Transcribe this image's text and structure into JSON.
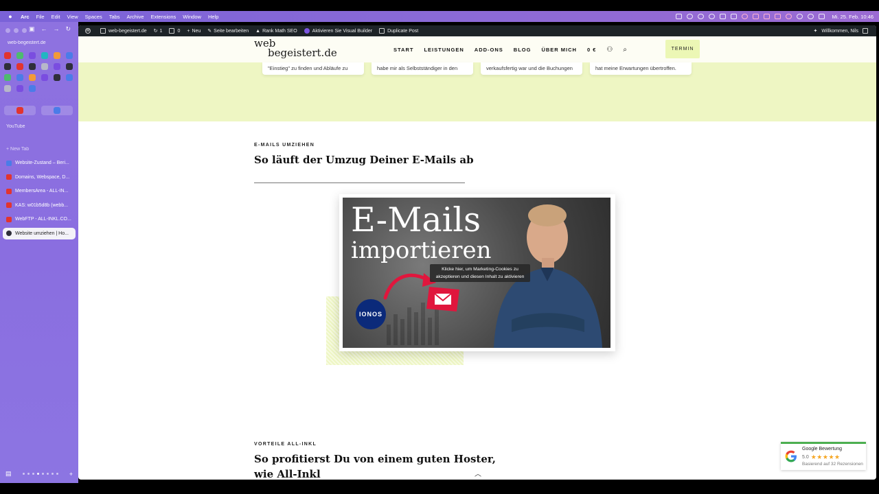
{
  "menubar": {
    "app": "Arc",
    "items": [
      "File",
      "Edit",
      "View",
      "Spaces",
      "Tabs",
      "Archive",
      "Extensions",
      "Window",
      "Help"
    ],
    "clock": "Mi. 25. Feb. 10:46"
  },
  "sidebar": {
    "url": "web-begeistert.de",
    "section_label": "YouTube",
    "new_tab": "+ New Tab",
    "tabs": [
      {
        "label": "Website-Zustand – Beri...",
        "color": "#4b7ce8"
      },
      {
        "label": "Domains, Webspace, D...",
        "color": "#e2342f"
      },
      {
        "label": "MembersArea - ALL-IN...",
        "color": "#e2342f"
      },
      {
        "label": "KAS: w01b5d8b (webb...",
        "color": "#e2342f"
      },
      {
        "label": "WebFTP - ALL-INKL.CO...",
        "color": "#e2342f"
      },
      {
        "label": "Website umziehen | Ho...",
        "color": "#2f2f3a"
      }
    ]
  },
  "wpbar": {
    "site": "web-begeistert.de",
    "updates": "1",
    "comments": "0",
    "new": "Neu",
    "edit": "Seite bearbeiten",
    "seo": "Rank Math SEO",
    "visual_builder": "Aktivieren Sie Visual Builder",
    "duplicate": "Duplicate Post",
    "welcome": "Willkommen, Nils"
  },
  "header": {
    "logo_line1": "web",
    "logo_line2": "begeistert.de",
    "nav": [
      "START",
      "LEISTUNGEN",
      "ADD-ONS",
      "BLOG",
      "ÜBER MICH"
    ],
    "cart": "0 €",
    "cta": "TERMIN"
  },
  "reviews": [
    "\"Einstieg\" zu finden und Abläufe zu",
    "habe mir als Selbstständiger in den",
    "verkaufsfertig war und die Buchungen",
    "hat meine Erwartungen übertroffen."
  ],
  "section1": {
    "eyebrow": "E-MAILS UMZIEHEN",
    "heading": "So läuft der Umzug Deiner E-Mails ab"
  },
  "video": {
    "title_line1": "E-Mails",
    "title_line2": "importieren",
    "ionos": "IONOS",
    "cookie_notice": "Klicke hier, um Marketing-Cookies zu akzeptieren und diesen Inhalt zu aktivieren"
  },
  "section2": {
    "eyebrow": "VORTEILE ALL-INKL",
    "heading_line1": "So profitierst Du von einem guten Hoster,",
    "heading_line2": "wie All-Inkl"
  },
  "google_badge": {
    "title": "Google Bewertung",
    "score": "5.0",
    "stars": "★★★★★",
    "subtitle": "Basierend auf 32 Rezensionen"
  }
}
